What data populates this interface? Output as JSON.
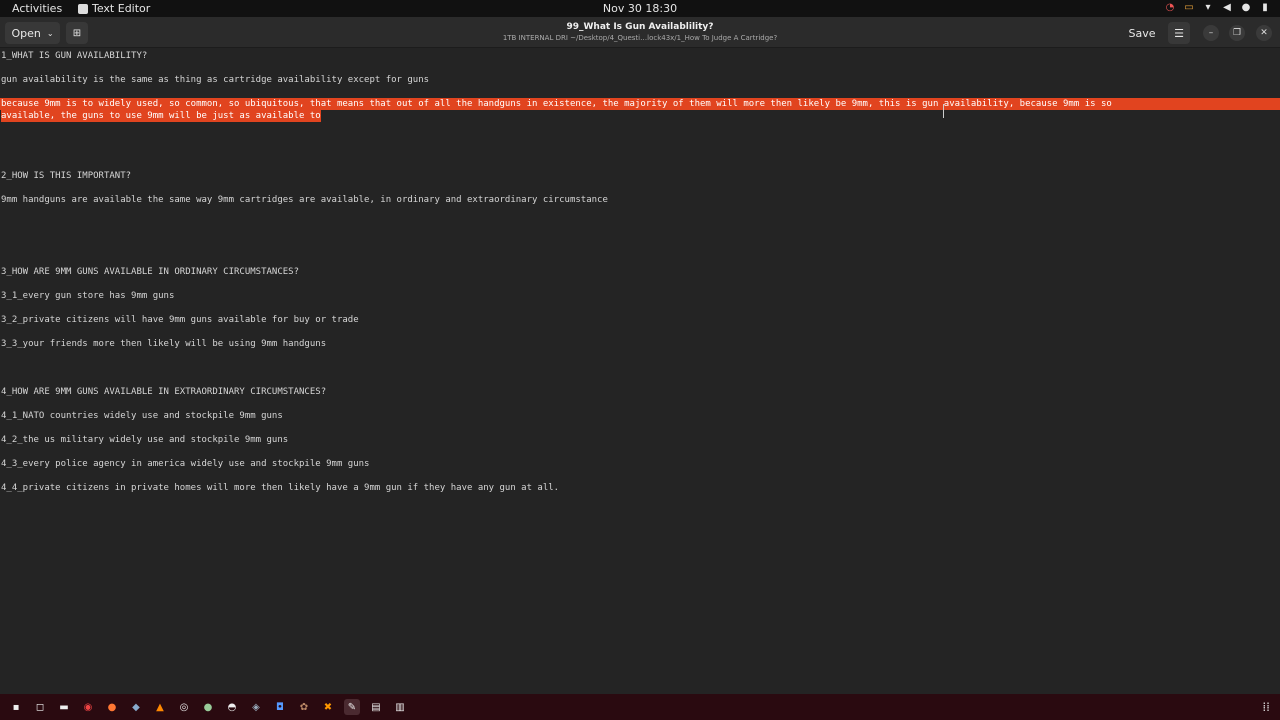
{
  "topbar": {
    "activities": "Activities",
    "app_name": "Text Editor",
    "clock": "Nov 30  18:30",
    "tray_icons": [
      "update-icon",
      "screen-share-icon",
      "wifi-icon",
      "volume-icon",
      "microphone-icon",
      "battery-icon"
    ]
  },
  "headerbar": {
    "open_label": "Open",
    "title": "99_What Is Gun Availablility?",
    "subtitle": "1TB INTERNAL DRI ~/Desktop/4_Questi…lock43x/1_How To Judge A Cartridge?",
    "save_label": "Save"
  },
  "document": {
    "lines": [
      "1_WHAT IS GUN AVAILABILITY?",
      "gun availability is the same as thing as cartridge availability except for guns",
      "because 9mm is to widely used, so common, so ubiquitous, that means that out of all the handguns in existence, the majority of them will more then likely be 9mm, this is gun availability, because 9mm is so",
      "available, the guns to use 9mm will be just as available to",
      "2_HOW IS THIS IMPORTANT?",
      "9mm handguns are available the same way 9mm cartridges are available, in ordinary and extraordinary circumstance",
      "3_HOW ARE 9MM GUNS AVAILABLE IN ORDINARY CIRCUMSTANCES?",
      "3_1_every gun store has 9mm guns",
      "3_2_private citizens will have 9mm guns available for buy or trade",
      "3_3_your friends more then likely will be using 9mm handguns",
      "4_HOW ARE 9MM GUNS AVAILABLE IN EXTRAORDINARY CIRCUMSTANCES?",
      "4_1_NATO countries widely use and stockpile 9mm guns",
      "4_2_the us military widely use and stockpile 9mm guns",
      "4_3_every police agency in america widely use and stockpile 9mm guns",
      "4_4_private citizens in private homes will more then likely have a 9mm gun if they have any gun at all."
    ]
  },
  "dock": {
    "apps": [
      "terminal",
      "disks",
      "files",
      "chrome",
      "firefox",
      "steam",
      "vlc",
      "obs",
      "xnview",
      "gimp",
      "app-utility",
      "keepass",
      "app-game",
      "app-x",
      "text-editor",
      "app-stack",
      "trash"
    ]
  },
  "colors": {
    "selection": "#e1441f",
    "background": "#242424",
    "dock": "#2a0a10"
  }
}
